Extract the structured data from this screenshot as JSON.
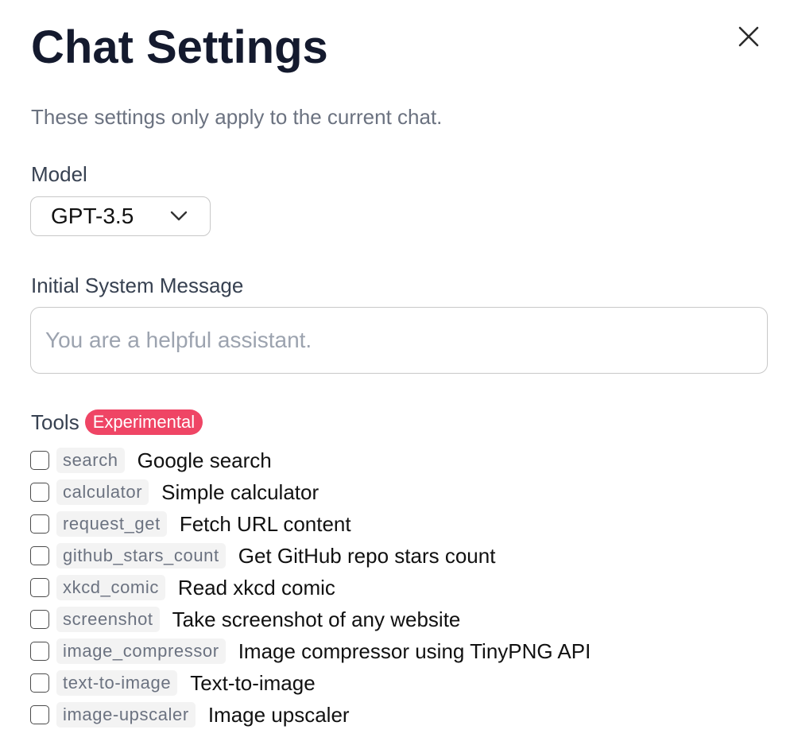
{
  "dialog": {
    "title": "Chat Settings",
    "subtitle": "These settings only apply to the current chat.",
    "close_icon": "close-icon"
  },
  "model": {
    "label": "Model",
    "selected": "GPT-3.5",
    "chevron_icon": "chevron-down-icon"
  },
  "system_message": {
    "label": "Initial System Message",
    "value": "",
    "placeholder": "You are a helpful assistant."
  },
  "tools": {
    "label": "Tools",
    "badge": "Experimental",
    "badge_color": "#ef4565",
    "items": [
      {
        "code": "search",
        "description": "Google search",
        "checked": false
      },
      {
        "code": "calculator",
        "description": "Simple calculator",
        "checked": false
      },
      {
        "code": "request_get",
        "description": "Fetch URL content",
        "checked": false
      },
      {
        "code": "github_stars_count",
        "description": "Get GitHub repo stars count",
        "checked": false
      },
      {
        "code": "xkcd_comic",
        "description": "Read xkcd comic",
        "checked": false
      },
      {
        "code": "screenshot",
        "description": "Take screenshot of any website",
        "checked": false
      },
      {
        "code": "image_compressor",
        "description": "Image compressor using TinyPNG API",
        "checked": false
      },
      {
        "code": "text-to-image",
        "description": "Text-to-image",
        "checked": false
      },
      {
        "code": "image-upscaler",
        "description": "Image upscaler",
        "checked": false
      }
    ]
  },
  "colors": {
    "title": "#141a2e",
    "muted_text": "#6b7280",
    "border": "#c8c8c8",
    "code_bg": "#f3f3f3"
  }
}
